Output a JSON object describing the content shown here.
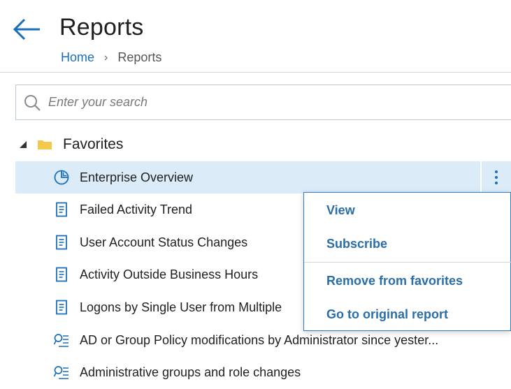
{
  "header": {
    "title": "Reports",
    "breadcrumb": {
      "home": "Home",
      "separator": "›",
      "current": "Reports"
    }
  },
  "search": {
    "placeholder": "Enter your search",
    "value": ""
  },
  "tree": {
    "group": {
      "label": "Favorites",
      "expanded": true
    },
    "items": [
      {
        "label": "Enterprise Overview",
        "icon": "pie-chart-icon",
        "selected": true
      },
      {
        "label": "Failed Activity Trend",
        "icon": "report-document-icon"
      },
      {
        "label": "User Account Status Changes",
        "icon": "report-document-icon"
      },
      {
        "label": "Activity Outside Business Hours",
        "icon": "report-document-icon"
      },
      {
        "label": "Logons by Single User from Multiple",
        "icon": "report-document-icon"
      },
      {
        "label": "AD or Group Policy modifications by Administrator since yester...",
        "icon": "search-report-icon"
      },
      {
        "label": "Administrative groups and role changes",
        "icon": "search-report-icon"
      }
    ]
  },
  "context_menu": {
    "items": [
      "View",
      "Subscribe",
      "Remove from favorites",
      "Go to original report"
    ]
  },
  "colors": {
    "accent": "#1a6fb8",
    "selected_row": "#dcebf8",
    "folder": "#f2c94c",
    "menu_text": "#2a6ea8"
  }
}
